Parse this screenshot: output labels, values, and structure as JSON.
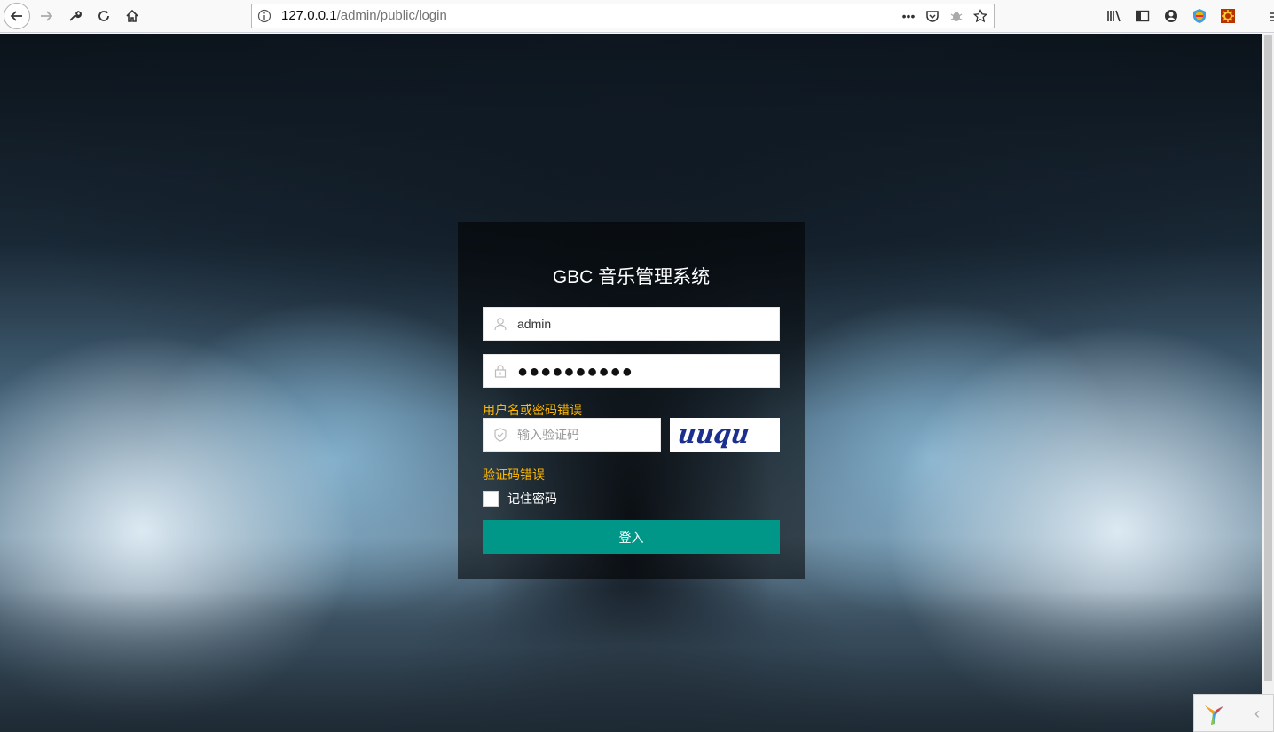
{
  "browser": {
    "url_host": "127.0.0.1",
    "url_path": "/admin/public/login"
  },
  "login": {
    "title": "GBC 音乐管理系统",
    "username_value": "admin",
    "password_value": "●●●●●●●●●●",
    "credential_error": "用户名或密码错误",
    "captcha_placeholder": "输入验证码",
    "captcha_text": "uuqu",
    "captcha_error": "验证码错误",
    "remember_label": "记住密码",
    "remember_checked": false,
    "submit_label": "登入"
  },
  "colors": {
    "accent": "#009688",
    "error": "#ffb800"
  }
}
